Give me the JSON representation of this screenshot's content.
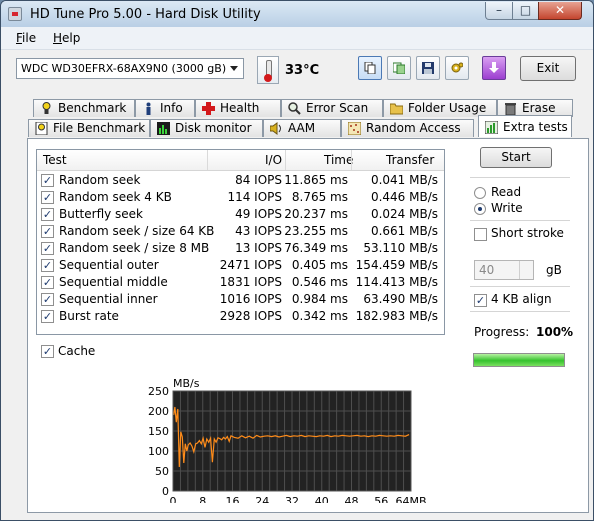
{
  "window": {
    "title": "HD Tune Pro 5.00 - Hard Disk Utility",
    "controls": {
      "minimize": "–",
      "maximize": "□",
      "close": "✕"
    }
  },
  "menu": [
    "File",
    "Help"
  ],
  "toolbar": {
    "drive": "WDC WD30EFRX-68AX9N0 (3000 gB)",
    "temperature": "33°C",
    "exit_label": "Exit"
  },
  "tabs_row1": [
    "Benchmark",
    "Info",
    "Health",
    "Error Scan",
    "Folder Usage",
    "Erase"
  ],
  "tabs_row2": [
    "File Benchmark",
    "Disk monitor",
    "AAM",
    "Random Access",
    "Extra tests"
  ],
  "active_tab": "Extra tests",
  "table": {
    "headers": [
      "Test",
      "I/O",
      "Time",
      "Transfer"
    ],
    "rows": [
      {
        "checked": true,
        "test": "Random seek",
        "io": "84 IOPS",
        "time": "11.865 ms",
        "transfer": "0.041 MB/s"
      },
      {
        "checked": true,
        "test": "Random seek 4 KB",
        "io": "114 IOPS",
        "time": "8.765 ms",
        "transfer": "0.446 MB/s"
      },
      {
        "checked": true,
        "test": "Butterfly seek",
        "io": "49 IOPS",
        "time": "20.237 ms",
        "transfer": "0.024 MB/s"
      },
      {
        "checked": true,
        "test": "Random seek / size 64 KB",
        "io": "43 IOPS",
        "time": "23.255 ms",
        "transfer": "0.661 MB/s"
      },
      {
        "checked": true,
        "test": "Random seek / size 8 MB",
        "io": "13 IOPS",
        "time": "76.349 ms",
        "transfer": "53.110 MB/s"
      },
      {
        "checked": true,
        "test": "Sequential outer",
        "io": "2471 IOPS",
        "time": "0.405 ms",
        "transfer": "154.459 MB/s"
      },
      {
        "checked": true,
        "test": "Sequential middle",
        "io": "1831 IOPS",
        "time": "0.546 ms",
        "transfer": "114.413 MB/s"
      },
      {
        "checked": true,
        "test": "Sequential inner",
        "io": "1016 IOPS",
        "time": "0.984 ms",
        "transfer": "63.490 MB/s"
      },
      {
        "checked": true,
        "test": "Burst rate",
        "io": "2928 IOPS",
        "time": "0.342 ms",
        "transfer": "182.983 MB/s"
      }
    ]
  },
  "cache": {
    "label": "Cache",
    "checked": true
  },
  "controls": {
    "start_label": "Start",
    "read_label": "Read",
    "write_label": "Write",
    "mode": "Write",
    "short_stroke_label": "Short stroke",
    "short_stroke_checked": false,
    "short_stroke_value": "40",
    "short_stroke_unit": "gB",
    "align_label": "4 KB align",
    "align_checked": true,
    "progress_label": "Progress:",
    "progress_text": "100%",
    "progress_value": 1.0
  },
  "colors": {
    "chart_bg": "#222222",
    "chart_grid": "#4e4e4e",
    "series": "#ff8c1a",
    "accent": "#4b79b5"
  },
  "chart_data": {
    "type": "line",
    "ylabel": "MB/s",
    "xunit": "MB",
    "xlim": [
      0,
      64
    ],
    "ylim": [
      0,
      250
    ],
    "yticks": [
      0,
      50,
      100,
      150,
      200,
      250
    ],
    "xticks": [
      0,
      8,
      16,
      24,
      32,
      40,
      48,
      56,
      64
    ],
    "grid": true,
    "series": [
      {
        "x": [
          0.2,
          0.5,
          0.9,
          1.3,
          1.7,
          2.1,
          2.5,
          2.9,
          3.3,
          3.7,
          4.1,
          4.6,
          5.1,
          5.6,
          6.1,
          6.6,
          7.1,
          7.6,
          8.1,
          8.6,
          9.1,
          9.6,
          10.1,
          10.6,
          11.1,
          11.6,
          12.1,
          12.6,
          13.1,
          13.6,
          14.1,
          14.6,
          15.1,
          15.6,
          16.5,
          17.5,
          18.5,
          19.5,
          20.5,
          21.5,
          22.5,
          23.5,
          24.5,
          25.5,
          26.5,
          27.5,
          28.5,
          29.5,
          30.5,
          31.5,
          32.5,
          33.5,
          34.5,
          35.5,
          36.5,
          37.5,
          38.5,
          39.5,
          40.5,
          41.5,
          42.5,
          43.5,
          44.5,
          45.5,
          46.5,
          47.5,
          48.5,
          49.5,
          50.5,
          51.5,
          52.5,
          53.5,
          54.5,
          55.5,
          56.5,
          57.5,
          58.5,
          59.5,
          60.5,
          61.5,
          62.5,
          63.5
        ],
        "y": [
          190,
          210,
          172,
          205,
          60,
          148,
          135,
          70,
          118,
          100,
          115,
          120,
          112,
          98,
          118,
          120,
          126,
          118,
          132,
          109,
          130,
          122,
          132,
          72,
          130,
          122,
          133,
          131,
          128,
          134,
          130,
          136,
          124,
          138,
          134,
          132,
          138,
          133,
          137,
          132,
          139,
          135,
          137,
          138,
          136,
          138,
          135,
          137,
          139,
          136,
          138,
          137,
          139,
          136,
          138,
          137,
          136,
          138,
          137,
          139,
          136,
          138,
          137,
          139,
          138,
          137,
          138,
          139,
          137,
          138,
          136,
          138,
          137,
          139,
          138,
          137,
          138,
          137,
          139,
          138,
          137,
          141
        ]
      }
    ]
  }
}
